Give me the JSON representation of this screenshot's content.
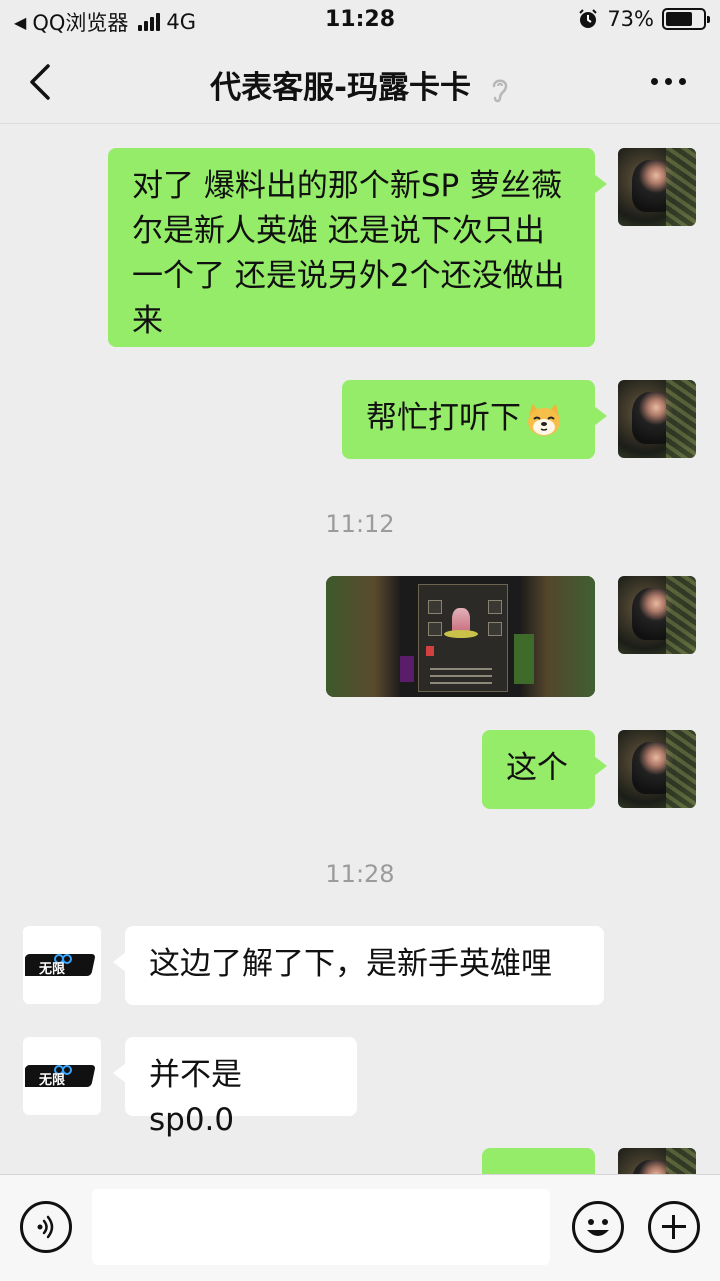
{
  "status_bar": {
    "back_app": "QQ浏览器",
    "network": "4G",
    "time": "11:28",
    "battery": "73%",
    "battery_level": 0.73
  },
  "nav": {
    "title": "代表客服-玛露卡卡"
  },
  "messages": [
    {
      "side": "right",
      "text": "对了 爆料出的那个新SP 萝丝薇尔是新人英雄 还是说下次只出一个了 还是说另外2个还没做出来"
    },
    {
      "side": "right",
      "text": "帮忙打听下"
    },
    {
      "type": "time",
      "text": "11:12"
    },
    {
      "side": "right",
      "type": "image"
    },
    {
      "side": "right",
      "text": "这个"
    },
    {
      "type": "time",
      "text": "11:28"
    },
    {
      "side": "left",
      "text": "这边了解了下，是新手英雄哩"
    },
    {
      "side": "left",
      "text": "并不是 sp0.0"
    }
  ],
  "brand_logo_text": "无限",
  "input": {
    "value": "",
    "placeholder": ""
  }
}
